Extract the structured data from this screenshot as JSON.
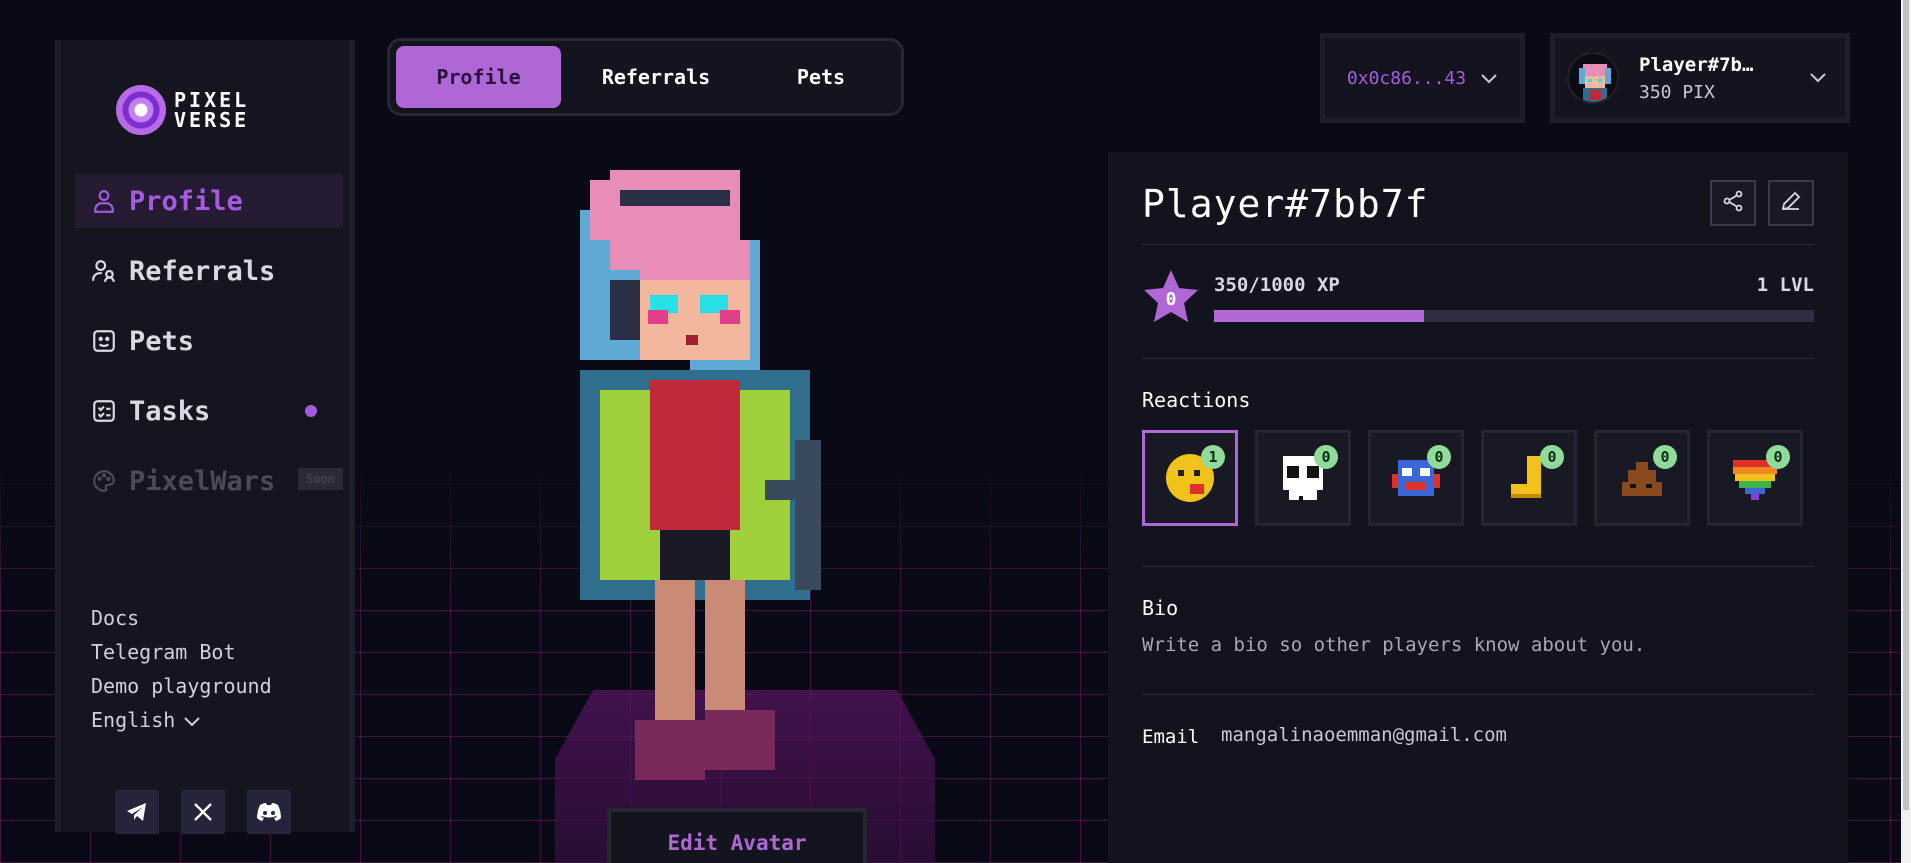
{
  "brand": {
    "line1": "PIXEL",
    "line2": "VERSE"
  },
  "sidebar": {
    "items": [
      {
        "label": "Profile",
        "icon": "user-icon",
        "active": true
      },
      {
        "label": "Referrals",
        "icon": "users-icon"
      },
      {
        "label": "Pets",
        "icon": "smile-icon"
      },
      {
        "label": "Tasks",
        "icon": "checklist-icon",
        "dot": true
      },
      {
        "label": "PixelWars",
        "icon": "palette-icon",
        "badge": "Soon",
        "disabled": true
      }
    ],
    "links": [
      "Docs",
      "Telegram Bot",
      "Demo playground",
      "English"
    ],
    "socials": [
      "telegram-icon",
      "x-icon",
      "discord-icon"
    ]
  },
  "tabs": [
    "Profile",
    "Referrals",
    "Pets"
  ],
  "wallet": {
    "address": "0x0c86...43"
  },
  "user": {
    "name": "Player#7b…",
    "balance": "350 PIX"
  },
  "profile": {
    "name": "Player#7bb7f",
    "level_star": "0",
    "xp_text": "350/1000 XP",
    "level_text": "1 LVL",
    "xp_progress": 0.35,
    "reactions_label": "Reactions",
    "reactions": [
      {
        "name": "kiss-emoji",
        "count": "1",
        "selected": true
      },
      {
        "name": "skull",
        "count": "0"
      },
      {
        "name": "robot-face",
        "count": "0"
      },
      {
        "name": "boot",
        "count": "0"
      },
      {
        "name": "poop",
        "count": "0"
      },
      {
        "name": "rainbow-heart",
        "count": "0"
      }
    ],
    "bio_label": "Bio",
    "bio_text": "Write a bio so other players know about you.",
    "email_label": "Email",
    "email_value": "mangalinaoemman@gmail.com"
  },
  "edit_avatar_label": "Edit Avatar",
  "colors": {
    "accent": "#b067d6",
    "background": "#0a0a16",
    "panel": "#13131d",
    "badge_green": "#8fdc9a"
  }
}
